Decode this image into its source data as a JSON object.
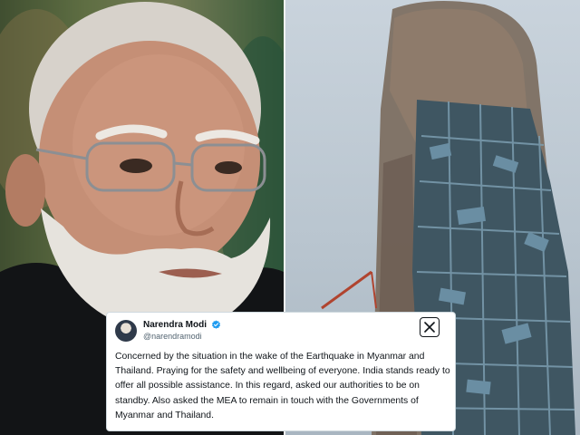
{
  "tweet": {
    "author_name": "Narendra Modi",
    "handle": "@narendramodi",
    "verified": true,
    "logo_icon": "x-logo-icon",
    "text": "Concerned by the situation in the wake of the Earthquake in Myanmar and Thailand. Praying for the safety and wellbeing of everyone. India stands ready to offer all possible assistance. In this regard, asked our authorities to be on standby. Also asked the MEA to remain in touch with the Governments of Myanmar and Thailand."
  },
  "colors": {
    "verified_badge": "#1d9bf0",
    "text_primary": "#0f1419",
    "text_secondary": "#536471",
    "card_border": "#cfd9de"
  }
}
